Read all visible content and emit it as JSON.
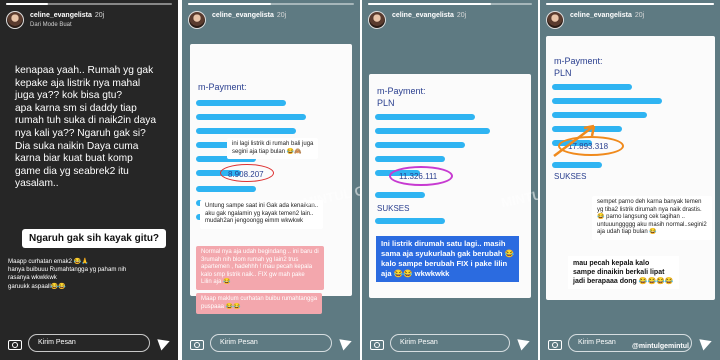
{
  "common": {
    "username": "celine_evangelista",
    "message_placeholder": "Kirim Pesan"
  },
  "story1": {
    "time": "20j",
    "subtitle": "Dari Mode Buat",
    "body": "kenapaa yaah.. Rumah yg gak\nkepake aja listrik nya mahal\njuga ya?? kok bisa gtu?\napa karna sm si daddy tiap\nrumah tuh suka di naik2in daya\nnya kali ya?? Ngaruh gak si?\nDia suka naikin Daya cuma\nkarna biar kuat buat komp\ngame dia yg seabrek2 itu\nyasalam..",
    "question": "Ngaruh gak sih kayak gitu?",
    "reply": "Maapp curhatan emak2 😂🙏\nhanya buibuuu Rumahtangga yg paham nih\nrasanya wkwkkwk\ngaruukk aspaall😂😂",
    "progress": 0.25
  },
  "story2": {
    "time": "20j",
    "mpayment": "m-Payment:",
    "value": "8.908.207",
    "caption_white": "ini lagi listrik di rumah bali juga\nsegini aja tiap bulan 😂🙈",
    "caption_white2": "Untung sampe saat ini Gak ada kenaikan..\naku gak ngalamin yg kayak temen2 lain..\nmudah2an jengoongg eimm wkwkwk",
    "caption_pink": "Normal nya aja udah begindang .. ini baru di\n3rumah nih blom rumah yg lain2 trus\napartemen , hadehhh ! mau pecah kepala\nkalo smp listrik naik.. FIX gw mah pake\nLilin aja 😂",
    "caption_pink2": "Maap maklum curhatan buibu rumahtangga\npuspaaa 😂😂",
    "progress": 0.5
  },
  "story3": {
    "time": "20j",
    "mpayment": "m-Payment:",
    "pln": "PLN",
    "value": "11.326.111",
    "label_sukses": "SUKSES",
    "caption_blue": "Ini listrik dirumah satu lagi.. masih\nsama aja syukurlaah gak berubah 😂\nkalo sampe berubah FIX i pake lilin\naja 😂😂 wkwkwkk",
    "progress": 0.75
  },
  "story4": {
    "time": "20j",
    "mpayment": "m-Payment:",
    "pln": "PLN",
    "value": "17.893.318",
    "label_sukses": "SUKSES",
    "caption_white": "sempet parno deh karna banyak temen\nyg tiba2 listrik dirumah nya naik drastis.\n😂 parno langsung cek tagihan ..\nuntuuunggggg aku masih normal..segini2\naja udah tiap bulan 😂",
    "caption_bottom": "mau pecah kepala kalo\nsampe dinaikin berkali lipat\njadi berapaaa dong 😂😂😂😂",
    "progress": 1.0
  },
  "watermark": "MINTUL\nGEMINTUL",
  "tag": "@mintulgemintul"
}
